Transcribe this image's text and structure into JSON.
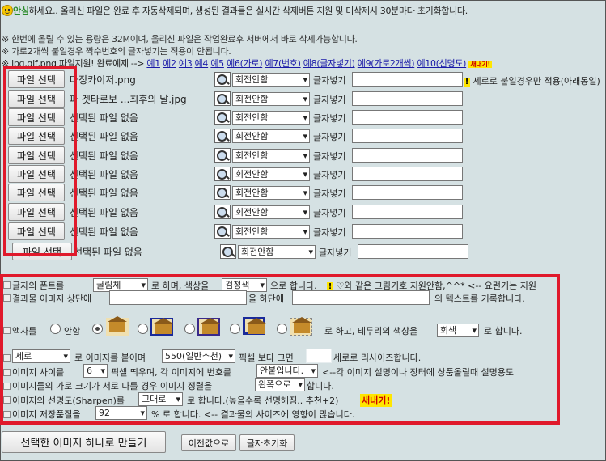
{
  "header": {
    "greet_strong": "안심",
    "greet_rest": "하세요.. 올리신 파일은 완료 후 자동삭제되며, 생성된 결과물은 실시간 삭제버튼 지원 및 미삭제시 30분마다 초기화합니다.",
    "info1": "※ 한번에 올릴 수 있는 용량은 32M이며, 올리신 파일은 작업완료후 서버에서 바로 삭제가능합니다.",
    "info2": "※ 가로2개씩 붙일경우 짝수번호의 글자넣기는 적용이 안됩니다.",
    "examples_prefix": "※ jpg,gif,png 파일지원! 완료예제 -->",
    "examples": [
      "예1",
      "예2",
      "예3",
      "예4",
      "예5",
      "예6(가로)",
      "예7(번호)",
      "예8(글자넣기)",
      "예9(가로2개씩)",
      "예10(선명도)"
    ],
    "new_badge": "새내기!"
  },
  "rows": [
    {
      "button": "파일 선택",
      "file": "마징카이저.png",
      "rotate": "회전안함",
      "text_label": "글자넣기"
    },
    {
      "button": "파일 선택",
      "file": "파 겟타로보 ...최후의 날.jpg",
      "rotate": "회전안함",
      "text_label": "글자넣기"
    },
    {
      "button": "파일 선택",
      "file": "선택된 파일 없음",
      "rotate": "회전안함",
      "text_label": "글자넣기"
    },
    {
      "button": "파일 선택",
      "file": "선택된 파일 없음",
      "rotate": "회전안함",
      "text_label": "글자넣기"
    },
    {
      "button": "파일 선택",
      "file": "선택된 파일 없음",
      "rotate": "회전안함",
      "text_label": "글자넣기"
    },
    {
      "button": "파일 선택",
      "file": "선택된 파일 없음",
      "rotate": "회전안함",
      "text_label": "글자넣기"
    },
    {
      "button": "파일 선택",
      "file": "선택된 파일 없음",
      "rotate": "회전안함",
      "text_label": "글자넣기"
    },
    {
      "button": "파일 선택",
      "file": "선택된 파일 없음",
      "rotate": "회전안함",
      "text_label": "글자넣기"
    },
    {
      "button": "파일 선택",
      "file": "선택된 파일 없음",
      "rotate": "회전안함",
      "text_label": "글자넣기"
    },
    {
      "button": "파일 선택",
      "file": "선택된 파일 없음",
      "rotate": "회전안함",
      "text_label": "글자넣기"
    }
  ],
  "row1_hint": "세로로 붙일경우만 적용(아래동일)",
  "options": {
    "font_prefix": "글자의 폰트를",
    "font_value": "굴림체",
    "font_mid": "로 하며, 색상을",
    "color_value": "검정색",
    "font_suffix": "으로 합니다.",
    "font_hint": "♡와 같은 그림기호 지원안함,^^* <-- 요런거는 지원",
    "top_prefix": "결과물 이미지 상단에",
    "top_mid": "을 하단에",
    "top_suffix": "의 텍스트를 기록합니다.",
    "frame_prefix": "액자를",
    "frame_none": "안함",
    "frame_suffix": "로 하고, 테두리의 색상을",
    "border_color": "회색",
    "frame_end": "로 합니다.",
    "dir_value": "세로",
    "dir_mid": "로 이미지를 붙이며",
    "size_value": "550(일반추천)",
    "size_mid": "픽셀 보다 크면",
    "size_suffix": "세로로 리사이즈합니다.",
    "gap_prefix": "이미지 사이를",
    "gap_value": "6",
    "gap_mid": "픽셀 띄우며, 각 이미지에 번호를",
    "num_value": "안붙입니다.",
    "gap_suffix": "<--각 이미지 설명이나 장터에 상품올릴때 설명용도",
    "align_prefix": "이미지들의 가로 크기가 서로 다를 경우 이미지 정렬을",
    "align_value": "왼쪽으로",
    "align_suffix": "합니다.",
    "sharp_prefix": "이미지의 선명도(Sharpen)를",
    "sharp_value": "그대로",
    "sharp_suffix": "로 합니다.(높을수록 선명해짐.. 추천+2)",
    "sharp_badge": "새내기!",
    "quality_prefix": "이미지 저장품질을",
    "quality_value": "92",
    "quality_suffix": "% 로 합니다. <-- 결과물의 사이즈에 영향이 많습니다."
  },
  "actions": {
    "make": "선택한 이미지 하나로 만들기",
    "prev": "이전값으로",
    "reset": "글자초기화"
  },
  "colors": {
    "highlight_border": "#e0192b",
    "background": "#d5e1e3",
    "link": "#1a1aa8"
  }
}
